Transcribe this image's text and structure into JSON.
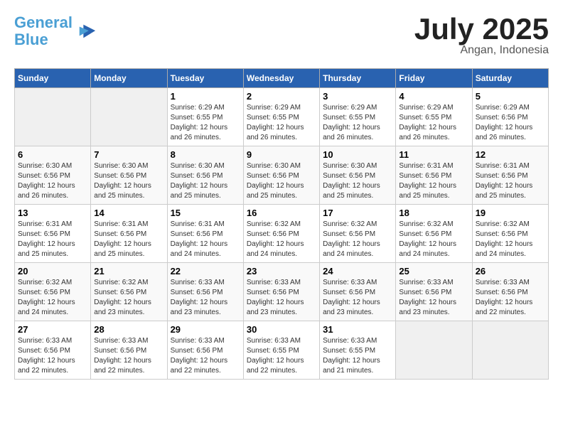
{
  "header": {
    "logo_line1": "General",
    "logo_line2": "Blue",
    "month_year": "July 2025",
    "location": "Angan, Indonesia"
  },
  "weekdays": [
    "Sunday",
    "Monday",
    "Tuesday",
    "Wednesday",
    "Thursday",
    "Friday",
    "Saturday"
  ],
  "weeks": [
    [
      {
        "day": "",
        "empty": true
      },
      {
        "day": "",
        "empty": true
      },
      {
        "day": "1",
        "sunrise": "6:29 AM",
        "sunset": "6:55 PM",
        "daylight": "12 hours and 26 minutes."
      },
      {
        "day": "2",
        "sunrise": "6:29 AM",
        "sunset": "6:55 PM",
        "daylight": "12 hours and 26 minutes."
      },
      {
        "day": "3",
        "sunrise": "6:29 AM",
        "sunset": "6:55 PM",
        "daylight": "12 hours and 26 minutes."
      },
      {
        "day": "4",
        "sunrise": "6:29 AM",
        "sunset": "6:55 PM",
        "daylight": "12 hours and 26 minutes."
      },
      {
        "day": "5",
        "sunrise": "6:29 AM",
        "sunset": "6:56 PM",
        "daylight": "12 hours and 26 minutes."
      }
    ],
    [
      {
        "day": "6",
        "sunrise": "6:30 AM",
        "sunset": "6:56 PM",
        "daylight": "12 hours and 26 minutes."
      },
      {
        "day": "7",
        "sunrise": "6:30 AM",
        "sunset": "6:56 PM",
        "daylight": "12 hours and 25 minutes."
      },
      {
        "day": "8",
        "sunrise": "6:30 AM",
        "sunset": "6:56 PM",
        "daylight": "12 hours and 25 minutes."
      },
      {
        "day": "9",
        "sunrise": "6:30 AM",
        "sunset": "6:56 PM",
        "daylight": "12 hours and 25 minutes."
      },
      {
        "day": "10",
        "sunrise": "6:30 AM",
        "sunset": "6:56 PM",
        "daylight": "12 hours and 25 minutes."
      },
      {
        "day": "11",
        "sunrise": "6:31 AM",
        "sunset": "6:56 PM",
        "daylight": "12 hours and 25 minutes."
      },
      {
        "day": "12",
        "sunrise": "6:31 AM",
        "sunset": "6:56 PM",
        "daylight": "12 hours and 25 minutes."
      }
    ],
    [
      {
        "day": "13",
        "sunrise": "6:31 AM",
        "sunset": "6:56 PM",
        "daylight": "12 hours and 25 minutes."
      },
      {
        "day": "14",
        "sunrise": "6:31 AM",
        "sunset": "6:56 PM",
        "daylight": "12 hours and 25 minutes."
      },
      {
        "day": "15",
        "sunrise": "6:31 AM",
        "sunset": "6:56 PM",
        "daylight": "12 hours and 24 minutes."
      },
      {
        "day": "16",
        "sunrise": "6:32 AM",
        "sunset": "6:56 PM",
        "daylight": "12 hours and 24 minutes."
      },
      {
        "day": "17",
        "sunrise": "6:32 AM",
        "sunset": "6:56 PM",
        "daylight": "12 hours and 24 minutes."
      },
      {
        "day": "18",
        "sunrise": "6:32 AM",
        "sunset": "6:56 PM",
        "daylight": "12 hours and 24 minutes."
      },
      {
        "day": "19",
        "sunrise": "6:32 AM",
        "sunset": "6:56 PM",
        "daylight": "12 hours and 24 minutes."
      }
    ],
    [
      {
        "day": "20",
        "sunrise": "6:32 AM",
        "sunset": "6:56 PM",
        "daylight": "12 hours and 24 minutes."
      },
      {
        "day": "21",
        "sunrise": "6:32 AM",
        "sunset": "6:56 PM",
        "daylight": "12 hours and 23 minutes."
      },
      {
        "day": "22",
        "sunrise": "6:33 AM",
        "sunset": "6:56 PM",
        "daylight": "12 hours and 23 minutes."
      },
      {
        "day": "23",
        "sunrise": "6:33 AM",
        "sunset": "6:56 PM",
        "daylight": "12 hours and 23 minutes."
      },
      {
        "day": "24",
        "sunrise": "6:33 AM",
        "sunset": "6:56 PM",
        "daylight": "12 hours and 23 minutes."
      },
      {
        "day": "25",
        "sunrise": "6:33 AM",
        "sunset": "6:56 PM",
        "daylight": "12 hours and 23 minutes."
      },
      {
        "day": "26",
        "sunrise": "6:33 AM",
        "sunset": "6:56 PM",
        "daylight": "12 hours and 22 minutes."
      }
    ],
    [
      {
        "day": "27",
        "sunrise": "6:33 AM",
        "sunset": "6:56 PM",
        "daylight": "12 hours and 22 minutes."
      },
      {
        "day": "28",
        "sunrise": "6:33 AM",
        "sunset": "6:56 PM",
        "daylight": "12 hours and 22 minutes."
      },
      {
        "day": "29",
        "sunrise": "6:33 AM",
        "sunset": "6:56 PM",
        "daylight": "12 hours and 22 minutes."
      },
      {
        "day": "30",
        "sunrise": "6:33 AM",
        "sunset": "6:55 PM",
        "daylight": "12 hours and 22 minutes."
      },
      {
        "day": "31",
        "sunrise": "6:33 AM",
        "sunset": "6:55 PM",
        "daylight": "12 hours and 21 minutes."
      },
      {
        "day": "",
        "empty": true
      },
      {
        "day": "",
        "empty": true
      }
    ]
  ]
}
